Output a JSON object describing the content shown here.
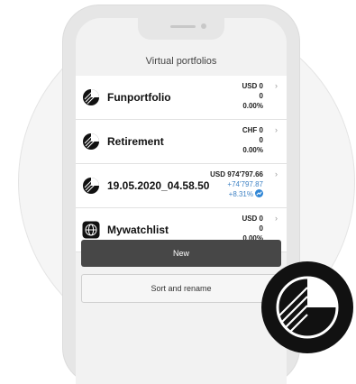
{
  "screen": {
    "title": "Virtual portfolios"
  },
  "portfolios": [
    {
      "name": "Funportfolio",
      "value": "USD 0",
      "change": "0",
      "percent": "0.00%",
      "icon": "portfolio-pie-icon"
    },
    {
      "name": "Retirement",
      "value": "CHF 0",
      "change": "0",
      "percent": "0.00%",
      "icon": "portfolio-pie-icon"
    },
    {
      "name": "19.05.2020_04.58.50",
      "value": "USD 974'797.66",
      "change": "+74'797.87",
      "percent": "+8.31%",
      "icon": "portfolio-pie-icon",
      "trend_icon": "trend-up-icon"
    },
    {
      "name": "Mywatchlist",
      "value": "USD 0",
      "change": "0",
      "percent": "0.00%",
      "icon": "globe-icon"
    }
  ],
  "buttons": {
    "new_label": "New",
    "sort_label": "Sort and rename"
  },
  "icons": {
    "chevron": "chevron-right-icon",
    "logo": "ubs-pie-logo"
  },
  "colors": {
    "positive": "#3f82c4",
    "primary_button": "#474747",
    "logo_bg": "#111111"
  }
}
